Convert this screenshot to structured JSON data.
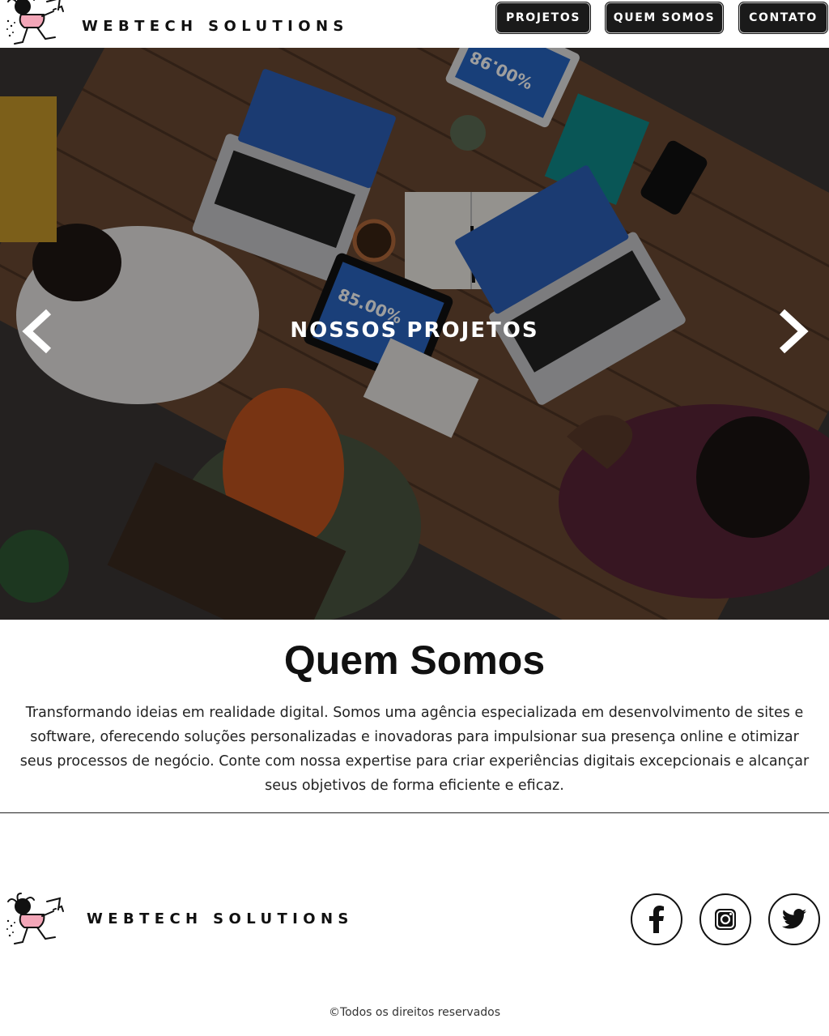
{
  "header": {
    "brand_name": "WEBTECH SOLUTIONS",
    "logo_icon": "running-character-logo",
    "nav": [
      {
        "label": "PROJETOS"
      },
      {
        "label": "QUEM SOMOS"
      },
      {
        "label": "CONTATO"
      }
    ]
  },
  "hero": {
    "title": "NOSSOS PROJETOS",
    "prev_icon": "chevron-left-icon",
    "next_icon": "chevron-right-icon",
    "tablet_text": "85.00%",
    "top_tablet_text": "%00.98"
  },
  "about": {
    "title": "Quem Somos",
    "text": "Transformando ideias em realidade digital. Somos uma agência especializada em desenvolvimento de sites e software, oferecendo soluções personalizadas e inovadoras para impulsionar sua presença online e otimizar seus processos de negócio. Conte com nossa expertise para criar experiências digitais excepcionais e alcançar seus objetivos de forma eficiente e eficaz."
  },
  "footer": {
    "brand_name": "WEBTECH SOLUTIONS",
    "social": [
      {
        "icon": "facebook-icon"
      },
      {
        "icon": "instagram-icon"
      },
      {
        "icon": "twitter-icon"
      }
    ],
    "copyright": "©Todos os direitos reservados"
  },
  "colors": {
    "nav_button_bg": "#1a1a1a",
    "text_primary": "#111111",
    "hero_title": "#ffffff"
  }
}
